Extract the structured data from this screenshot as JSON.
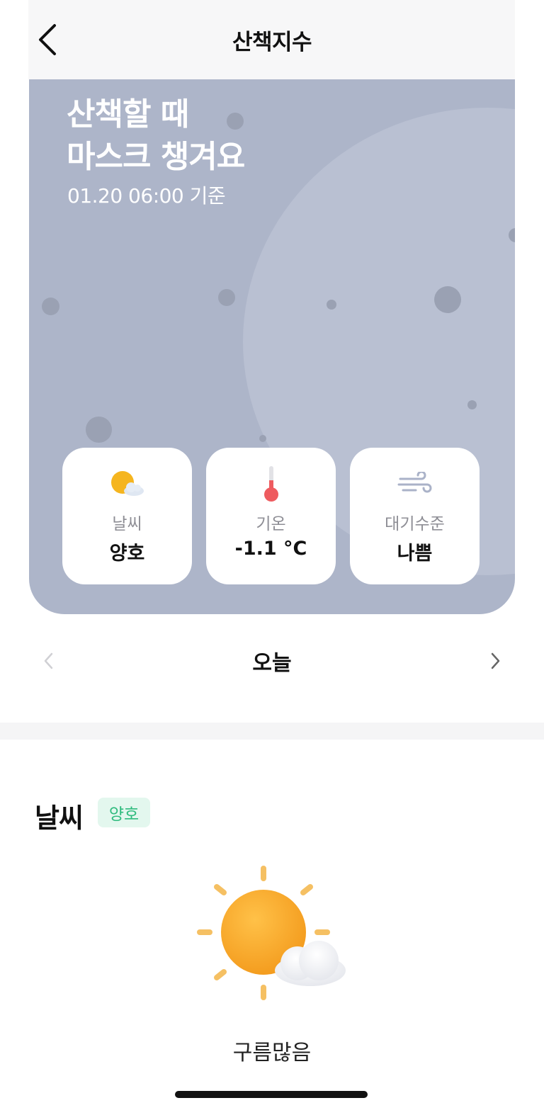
{
  "header": {
    "title": "산책지수",
    "back_icon": "chevron-left-icon"
  },
  "hero": {
    "title": "산책할 때\n마스크 챙겨요",
    "timestamp": "01.20 06:00 기준",
    "background_color": "#adb5c9"
  },
  "cards": [
    {
      "icon": "sun-cloud-icon",
      "label": "날씨",
      "value": "양호"
    },
    {
      "icon": "thermometer-icon",
      "label": "기온",
      "value": "-1.1 °C"
    },
    {
      "icon": "wind-icon",
      "label": "대기수준",
      "value": "나쁨"
    }
  ],
  "day_nav": {
    "label": "오늘",
    "prev_icon": "chevron-left-icon",
    "next_icon": "chevron-right-icon"
  },
  "weather": {
    "title": "날씨",
    "badge": "양호",
    "badge_color": "#2fbb7e",
    "icon": "sun-cloud-icon",
    "description": "구름많음"
  }
}
